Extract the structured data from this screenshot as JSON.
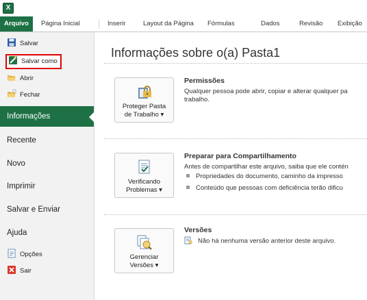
{
  "ribbon": {
    "tabs": [
      "Arquivo",
      "Página Inicial",
      "Inserir",
      "Layout da Página",
      "Fórmulas",
      "Dados",
      "Revisão",
      "Exibição"
    ],
    "active_tab": "Arquivo"
  },
  "backstage": {
    "commands_top": [
      {
        "label": "Salvar",
        "icon": "save-icon"
      },
      {
        "label": "Salvar como",
        "icon": "save-as-icon",
        "highlighted": true
      },
      {
        "label": "Abrir",
        "icon": "open-folder-icon"
      },
      {
        "label": "Fechar",
        "icon": "close-folder-icon"
      }
    ],
    "nav_items": [
      {
        "label": "Informações",
        "selected": true
      },
      {
        "label": "Recente"
      },
      {
        "label": "Novo"
      },
      {
        "label": "Imprimir"
      },
      {
        "label": "Salvar e Enviar"
      },
      {
        "label": "Ajuda"
      }
    ],
    "commands_bottom": [
      {
        "label": "Opções",
        "icon": "options-icon"
      },
      {
        "label": "Sair",
        "icon": "exit-icon"
      }
    ]
  },
  "main": {
    "title": "Informações sobre o(a) Pasta1",
    "sections": [
      {
        "button_label_line1": "Proteger Pasta",
        "button_label_line2": "de Trabalho ▾",
        "heading": "Permissões",
        "text": "Qualquer pessoa pode abrir, copiar e alterar qualquer pa trabalho."
      },
      {
        "button_label_line1": "Verificando",
        "button_label_line2": "Problemas ▾",
        "heading": "Preparar para Compartilhamento",
        "text": "Antes de compartilhar este arquivo, saiba que ele contén",
        "bullets": [
          "Propriedades do documento, caminho da impresso",
          "Conteúdo que pessoas com deficiência terão dificu"
        ]
      },
      {
        "button_label_line1": "Gerenciar",
        "button_label_line2": "Versões ▾",
        "heading": "Versões",
        "text": "Não há nenhuma versão anterior deste arquivo."
      }
    ]
  },
  "colors": {
    "accent": "#1e7145",
    "highlight_border": "#e00000"
  }
}
